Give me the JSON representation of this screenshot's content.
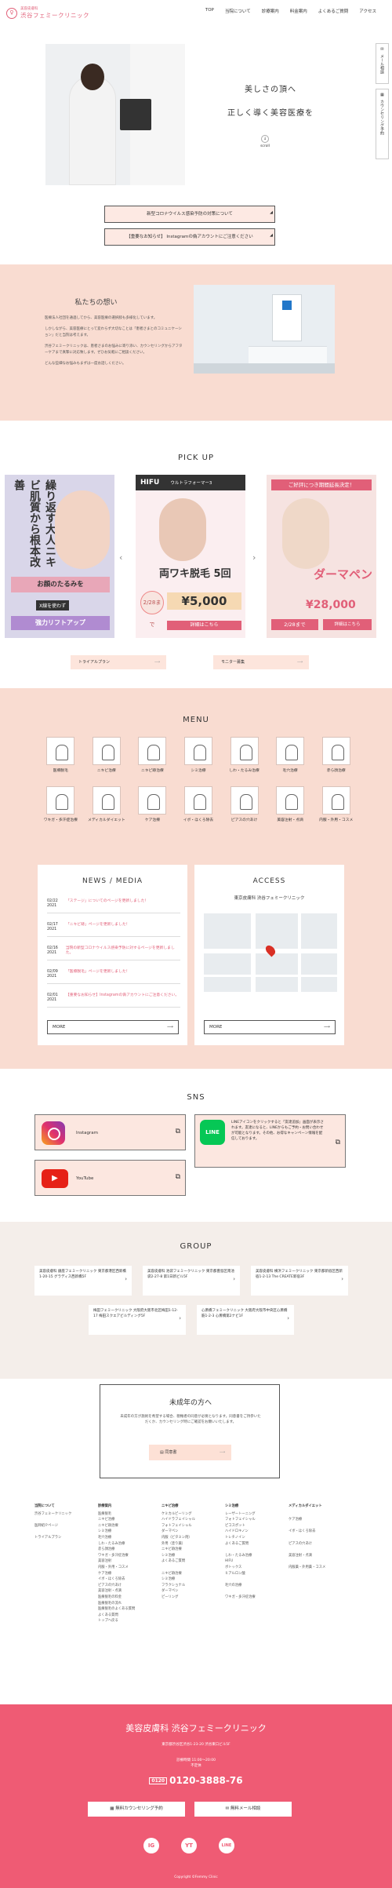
{
  "header": {
    "logo_sub": "美容皮膚科",
    "logo_main": "渋谷フェミークリニック",
    "nav": [
      "TOP",
      "当院について",
      "診療案内",
      "料金案内",
      "よくあるご質問",
      "アクセス"
    ]
  },
  "side_tabs": [
    "メール相談",
    "カウンセリング予約"
  ],
  "hero": {
    "line1": "美しさの頂へ",
    "line2": "正しく導く美容医療を",
    "scroll": "scroll"
  },
  "notices": [
    "新型コロナウイルス感染予防の対策について",
    "【重要なお知らせ】 Instagramの偽アカウントにご注意ください"
  ],
  "about": {
    "title": "私たちの想い",
    "paragraphs": [
      "医療法人社団を通過してから、美容医療の選択肢も多様化しています。",
      "しかしながら、美容医療にとって変わらず大切なことは「患者さまとのコミュニケーション」だと当院は考えます。",
      "渋谷フェミークリニックは、患者さまのお悩みに寄り添い、カウンセリングからアフターケアまで真摯に対応致します。ぜひお気軽にご相談ください。",
      "どんな些細なお悩みもまずは一度お話しください。"
    ]
  },
  "pickup": {
    "title": "PICK UP",
    "card1": {
      "vertical": "繰り返す大人ニキビ肌質から根本改善",
      "cta1": "お顔のたるみを",
      "cta2": "強力リフトアップ",
      "small": "X線を使わず"
    },
    "card2": {
      "brand": "HIFU",
      "sub": "ウルトラフォーマー3",
      "headline": "両ワキ脱毛 5回",
      "date": "2/28まで",
      "price": "¥5,000",
      "button": "詳細はこちら"
    },
    "card3": {
      "banner": "ご好評につき期間延長決定！",
      "headline": "ダーマペン",
      "price": "¥28,000",
      "date": "2/28まで",
      "button": "詳細はこちら"
    },
    "buttons": [
      "トライアルプラン",
      "モニター募集"
    ],
    "arrow_left": "‹",
    "arrow_right": "›"
  },
  "menu": {
    "title": "MENU",
    "items": [
      "医療脱毛",
      "ニキビ治療",
      "ニキビ跡治療",
      "シミ治療",
      "しわ・たるみ治療",
      "毛穴治療",
      "赤ら顔治療",
      "ワキガ・多汗症治療",
      "メディカルダイエット",
      "ケア治療",
      "イボ・ほくろ除去",
      "ピアスの穴あけ",
      "美容注射・点滴",
      "内服・外用・コスメ"
    ]
  },
  "news": {
    "title": "NEWS / MEDIA",
    "rows": [
      {
        "date": "02/22 2021",
        "text": "「ステージ」についてのページを更新しました！"
      },
      {
        "date": "02/17 2021",
        "text": "「ニキビ跡」ページを更新しました！"
      },
      {
        "date": "02/16 2021",
        "text": "当院の新型コロナウイルス感染予防に対するページを更新しました。"
      },
      {
        "date": "02/09 2021",
        "text": "「医療脱毛」ページを更新しました！"
      },
      {
        "date": "02/01 2021",
        "text": "【重要なお知らせ】Instagramの偽アカウントにご注意ください。"
      }
    ],
    "more": "MORE"
  },
  "access": {
    "title": "ACCESS",
    "address": "東京皮膚科 渋谷フェミークリニック",
    "more": "MORE"
  },
  "sns": {
    "title": "SNS",
    "instagram": "Instagram",
    "youtube": "YouTube",
    "line_icon": "LINE",
    "line_text": "LINEアイコンをクリックすると「友達追加」画面が表示されます。友達になると、LINEからもご予約・お問い合わせが可能となります。その他、お得なキャンペーン情報を配信しております。",
    "youtube_glyph": "▶"
  },
  "group": {
    "title": "GROUP",
    "cards": [
      "美容皮膚科 銀座フェミークリニック 東京都港区西新橋1-20-15 グラディス西新橋5F",
      "美容皮膚科 池袋フェミークリニック 東京都豊島区南池袋2-27-8 第1日新ビル5F",
      "美容皮膚科 横浜フェミークリニック 東京都新宿区西新宿1-2-13 The CREATE新宿3F",
      "梅田フェミークリニック 大阪府大阪市北区梅田1-12-17 梅田スクエアビルディング5F",
      "心斎橋フェミークリニック 大阪府大阪市中央区心斎橋筋1-2-3 心斎橋第2ナビ1F"
    ]
  },
  "minor": {
    "title": "未成年の方へ",
    "text": "未成年の方が施術を希望する場合、親権者の同意が必要となります。同意書をご持参いただくか、カウンセリング時にご確認をお願いいたします。",
    "button": "同意書"
  },
  "footer_cols": [
    {
      "head": "当院について",
      "items": [
        "渋谷フェミークリニック",
        "",
        "医師紹介ページ",
        "",
        "トライアルプラン"
      ]
    },
    {
      "head": "診療案内",
      "items": [
        "医療脱毛",
        "ニキビ治療",
        "ニキビ跡治療",
        "シミ治療",
        "毛穴治療",
        "しわ・たるみ治療",
        "赤ら顔治療",
        "ワキガ・多汗症治療",
        "美容注射",
        "内服・外用・コスメ",
        "ケア治療",
        "イボ・ほくろ除去",
        "ピアスの穴あけ",
        "美容注射・点滴",
        "医療脱毛の料金",
        "医療脱毛の流れ",
        "医療脱毛のよくある質問",
        "よくある質問",
        "トップへ戻る"
      ]
    },
    {
      "head": "ニキビ治療",
      "items": [
        "ケミカルピーリング",
        "ハイドラフェイシャル",
        "フォトフェイシャル",
        "ダーマペン",
        "内服（ビタミン剤）",
        "外用（塗り薬）",
        "ニキビ跡治療",
        "シミ治療",
        "よくあるご質問",
        "",
        "ニキビ跡治療",
        "シミ治療",
        "フラクショナル",
        "ダーマペン",
        "ピーリング"
      ]
    },
    {
      "head": "シミ治療",
      "items": [
        "レーザートーニング",
        "フォトフェイシャル",
        "ピコスポット",
        "ハイドロキノン",
        "トレチノイン",
        "よくあるご質問",
        "",
        "しわ・たるみ治療",
        "HIFU",
        "ボトックス",
        "ヒアルロン酸",
        "",
        "毛穴の治療",
        "",
        "ワキガ・多汗症治療"
      ]
    },
    {
      "head": "メディカルダイエット",
      "items": [
        "",
        "ケア治療",
        "",
        "イボ・ほくろ除去",
        "",
        "ピアスの穴あけ",
        "",
        "美容注射・点滴",
        "",
        "内服薬・外用薬・コスメ"
      ]
    }
  ],
  "footer": {
    "title": "美容皮膚科 渋谷フェミークリニック",
    "address": "東京都渋谷区渋谷1-23-20 渋谷東口ビル5F",
    "hours": "診療時間 11:00～20:00",
    "closed": "不定休",
    "tel": "0120-3888-76",
    "tel_badge": "0120",
    "btn1": "無料カウンセリング予約",
    "btn2": "無料メール相談",
    "sns": [
      "IG",
      "YT",
      "LINE"
    ],
    "copyright": "Copyright ©Femmy Clinic"
  }
}
